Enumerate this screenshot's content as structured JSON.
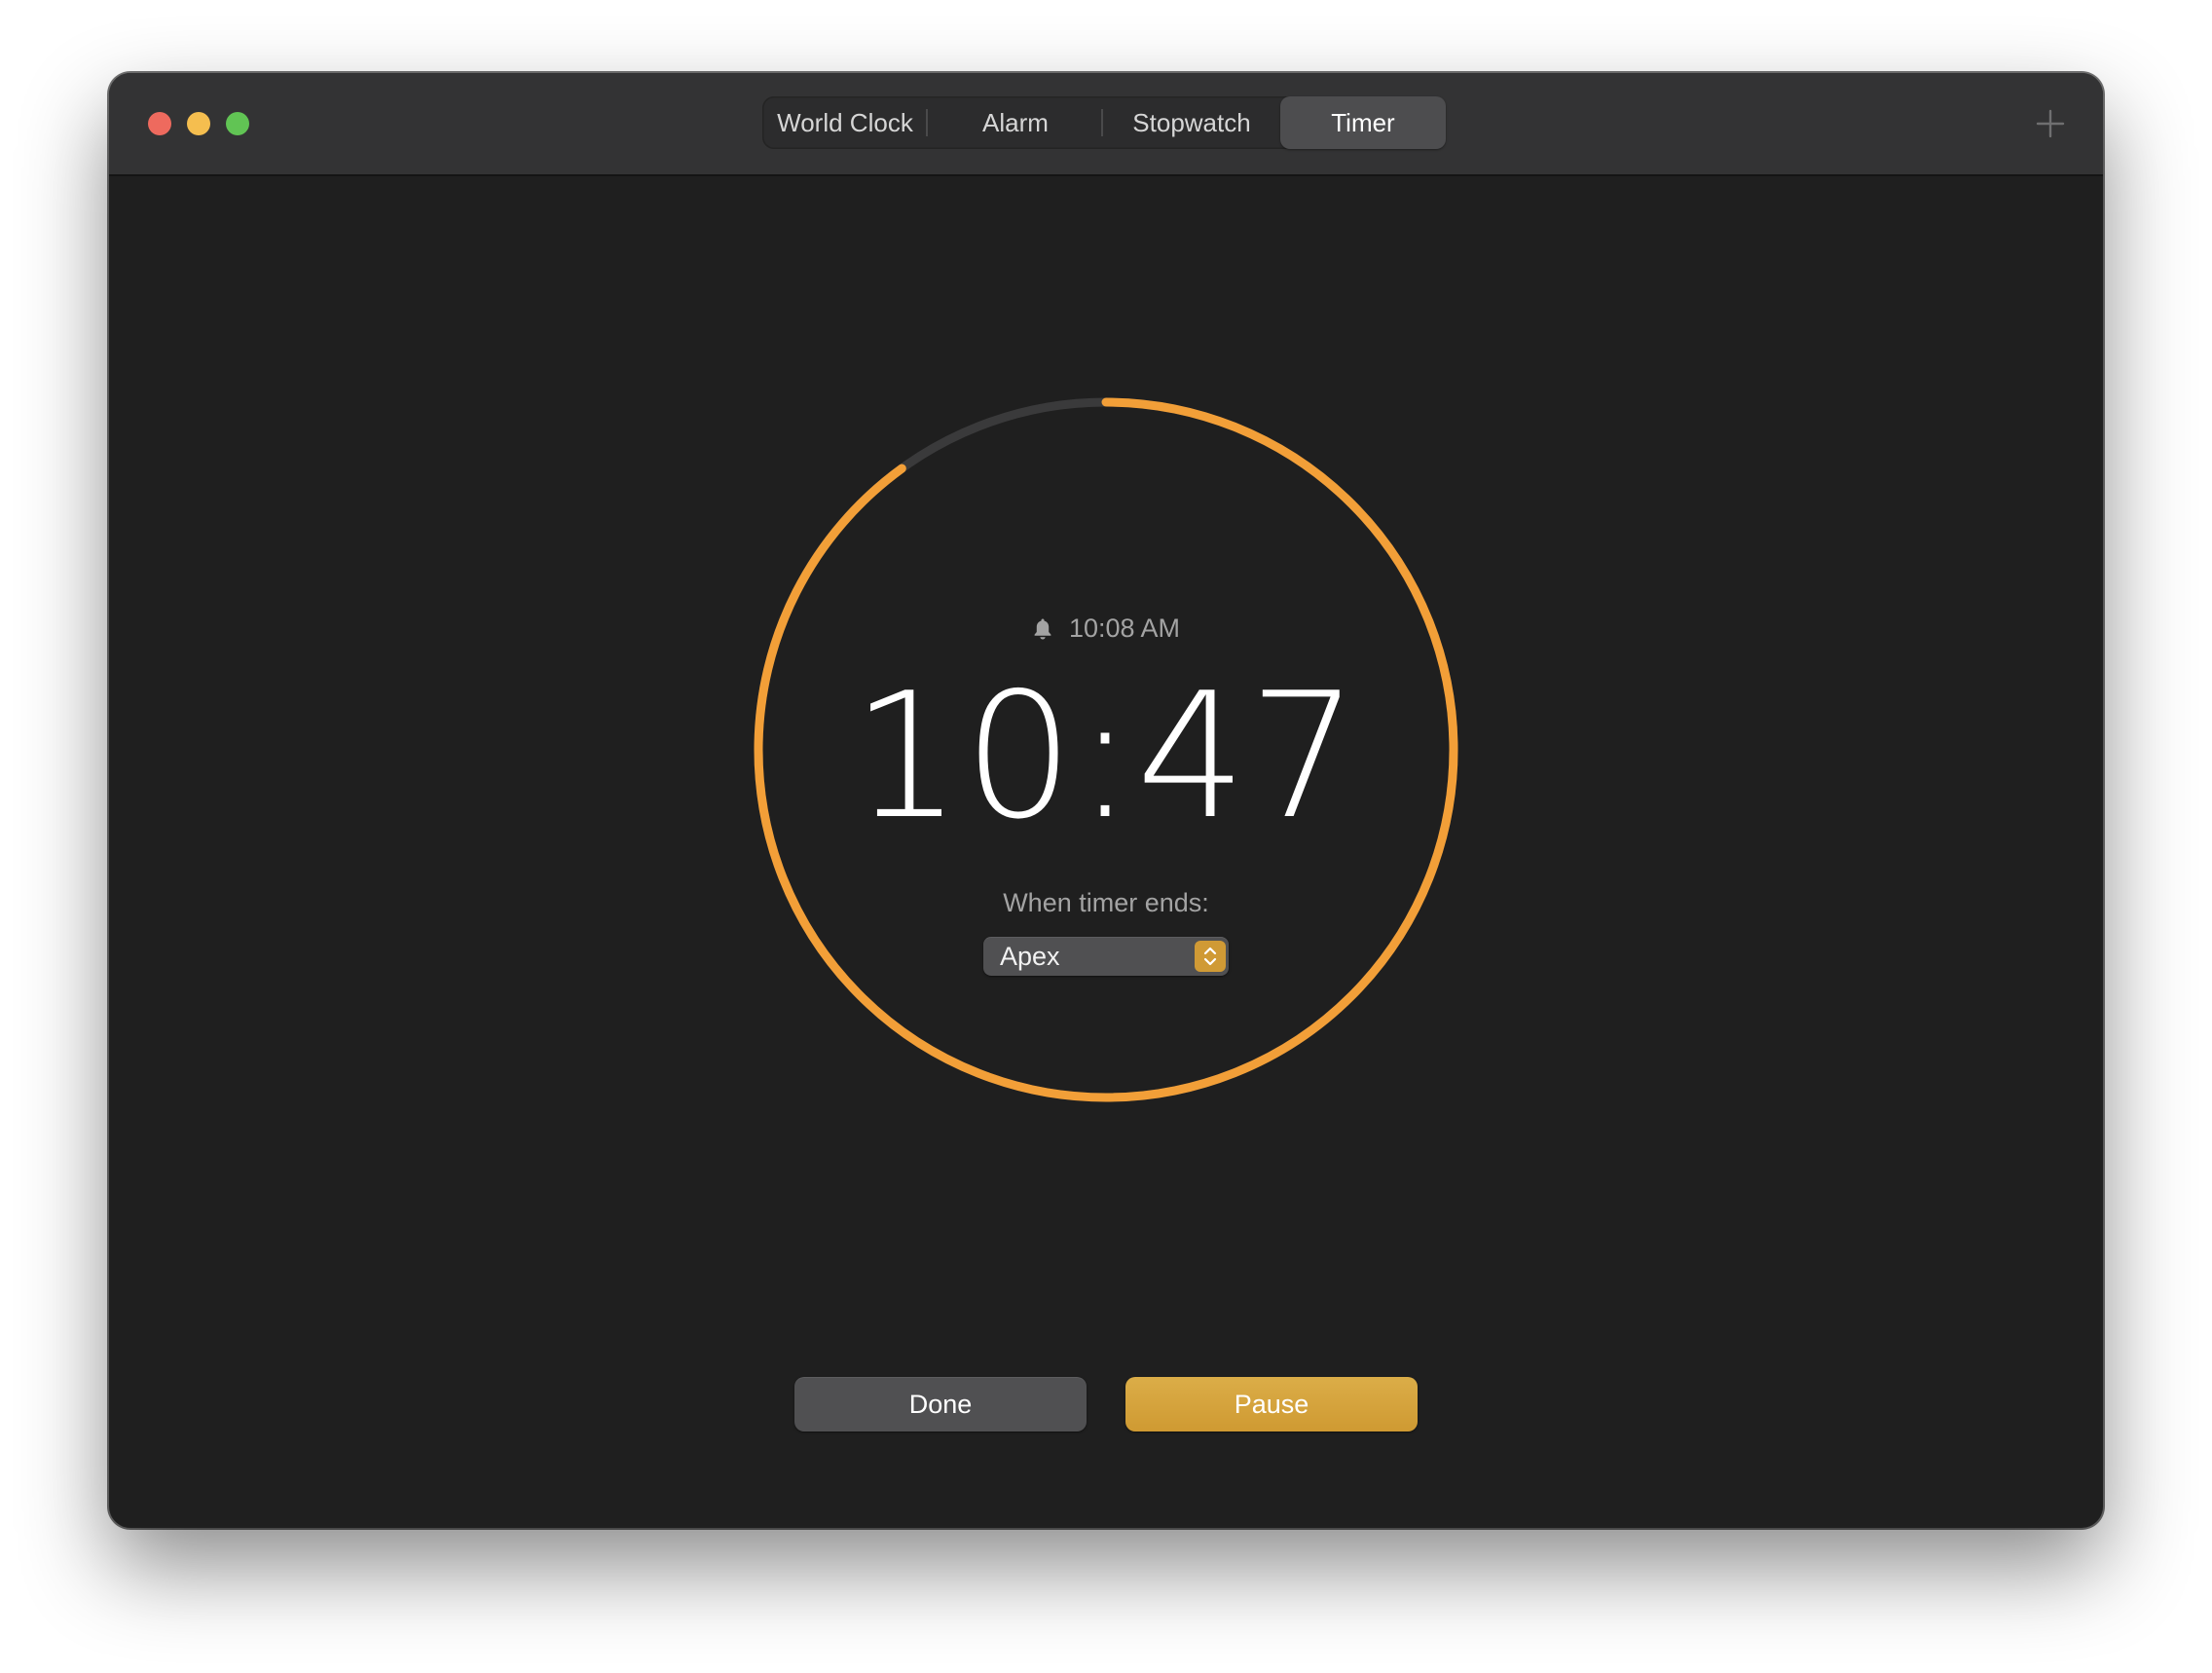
{
  "window": {
    "controls": [
      "close",
      "minimize",
      "maximize"
    ]
  },
  "tabs": [
    {
      "label": "World Clock",
      "active": false
    },
    {
      "label": "Alarm",
      "active": false
    },
    {
      "label": "Stopwatch",
      "active": false
    },
    {
      "label": "Timer",
      "active": true
    }
  ],
  "toolbar": {
    "add_icon": "plus-icon"
  },
  "timer": {
    "alarm_time": "10:08 AM",
    "alarm_icon": "bell-icon",
    "remaining": "10:47",
    "remaining_fraction": 0.9,
    "ends_label": "When timer ends:",
    "sound": "Apex"
  },
  "actions": {
    "done_label": "Done",
    "pause_label": "Pause"
  },
  "colors": {
    "accent": "#f29f38",
    "track": "#3a3a3b",
    "button_primary": "#d4a13c",
    "window_bg": "#1f1f1f",
    "titlebar_bg": "#333334"
  }
}
